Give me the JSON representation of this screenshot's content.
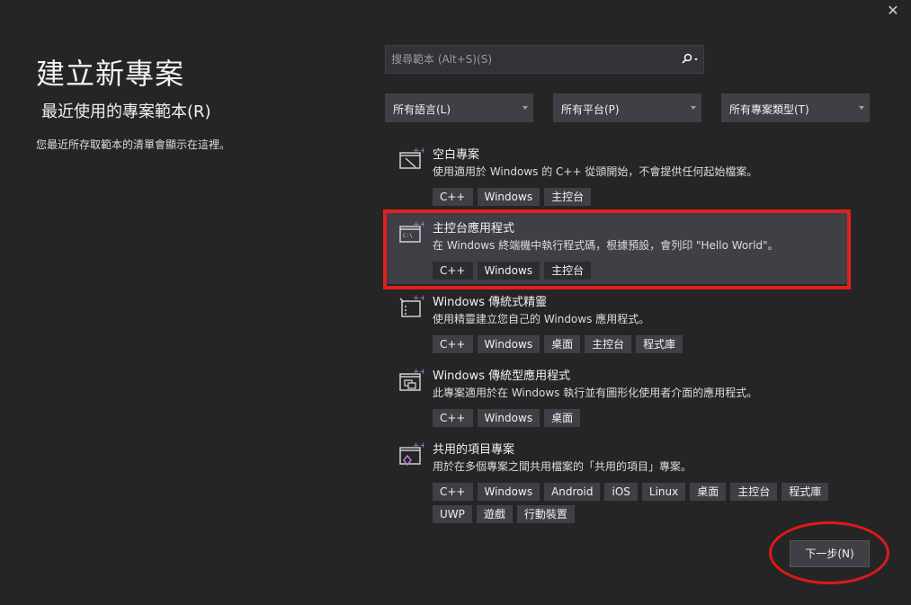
{
  "window": {
    "close_glyph": "✕"
  },
  "page": {
    "title": "建立新專案",
    "recent_heading": "最近使用的專案範本(R)",
    "recent_empty_text": "您最近所存取範本的清單會顯示在這裡。"
  },
  "search": {
    "placeholder": "搜尋範本 (Alt+S)(S)"
  },
  "filters": {
    "language": "所有語言(L)",
    "platform": "所有平台(P)",
    "project_type": "所有專案類型(T)"
  },
  "templates": [
    {
      "icon": "empty-project-icon",
      "title": "空白專案",
      "description": "使用適用於 Windows 的 C++ 從頭開始，不會提供任何起始檔案。",
      "tags": [
        "C++",
        "Windows",
        "主控台"
      ]
    },
    {
      "icon": "console-app-icon",
      "title": "主控台應用程式",
      "description": "在 Windows 終端機中執行程式碼，根據預設，會列印 \"Hello World\"。",
      "tags": [
        "C++",
        "Windows",
        "主控台"
      ]
    },
    {
      "icon": "desktop-wizard-icon",
      "title": "Windows 傳統式精靈",
      "description": "使用精靈建立您自己的 Windows 應用程式。",
      "tags": [
        "C++",
        "Windows",
        "桌面",
        "主控台",
        "程式庫"
      ]
    },
    {
      "icon": "desktop-app-icon",
      "title": "Windows 傳統型應用程式",
      "description": "此專案適用於在 Windows 執行並有圖形化使用者介面的應用程式。",
      "tags": [
        "C++",
        "Windows",
        "桌面"
      ]
    },
    {
      "icon": "shared-items-icon",
      "title": "共用的項目專案",
      "description": "用於在多個專案之間共用檔案的「共用的項目」專案。",
      "tags": [
        "C++",
        "Windows",
        "Android",
        "iOS",
        "Linux",
        "桌面",
        "主控台",
        "程式庫",
        "UWP",
        "遊戲",
        "行動裝置"
      ]
    }
  ],
  "footer": {
    "next_button": "下一步(N)"
  },
  "colors": {
    "background": "#252526",
    "selected_row": "#3f3f46",
    "annotation_red": "#e02020",
    "icon_purple": "#b180d7"
  }
}
